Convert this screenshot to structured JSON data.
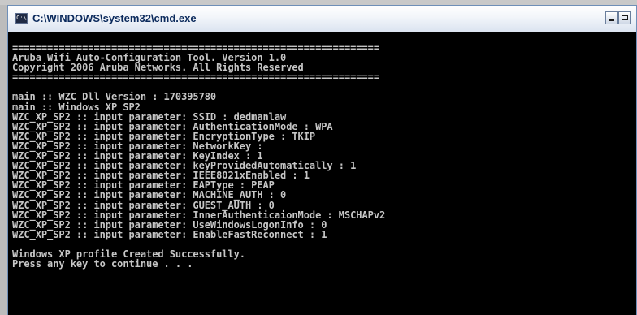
{
  "window": {
    "title": "C:\\WINDOWS\\system32\\cmd.exe",
    "icon_label": "C:\\"
  },
  "console": {
    "lines": [
      "===============================================================",
      "Aruba Wifi Auto-Configuration Tool. Version 1.0",
      "Copyright 2006 Aruba Networks. All Rights Reserved",
      "===============================================================",
      "",
      "main :: WZC Dll Version : 170395780",
      "main :: Windows XP SP2",
      "WZC_XP_SP2 :: input parameter: SSID : dedmanlaw",
      "WZC_XP_SP2 :: input parameter: AuthenticationMode : WPA",
      "WZC_XP_SP2 :: input parameter: EncryptionType : TKIP",
      "WZC_XP_SP2 :: input parameter: NetworkKey :",
      "WZC_XP_SP2 :: input parameter: KeyIndex : 1",
      "WZC_XP_SP2 :: input parameter: keyProvidedAutomatically : 1",
      "WZC_XP_SP2 :: input parameter: IEEE8021xEnabled : 1",
      "WZC_XP_SP2 :: input parameter: EAPType : PEAP",
      "WZC_XP_SP2 :: input parameter: MACHINE_AUTH : 0",
      "WZC_XP_SP2 :: input parameter: GUEST_AUTH : 0",
      "WZC_XP_SP2 :: input parameter: InnerAuthenticaionMode : MSCHAPv2",
      "WZC_XP_SP2 :: input parameter: UseWindowsLogonInfo : 0",
      "WZC_XP_SP2 :: input parameter: EnableFastReconnect : 1",
      "",
      "Windows XP profile Created Successfully.",
      "Press any key to continue . . ."
    ]
  },
  "colors": {
    "console_bg": "#000000",
    "console_text": "#c6c6c6",
    "title_text": "#0b2a5c"
  }
}
